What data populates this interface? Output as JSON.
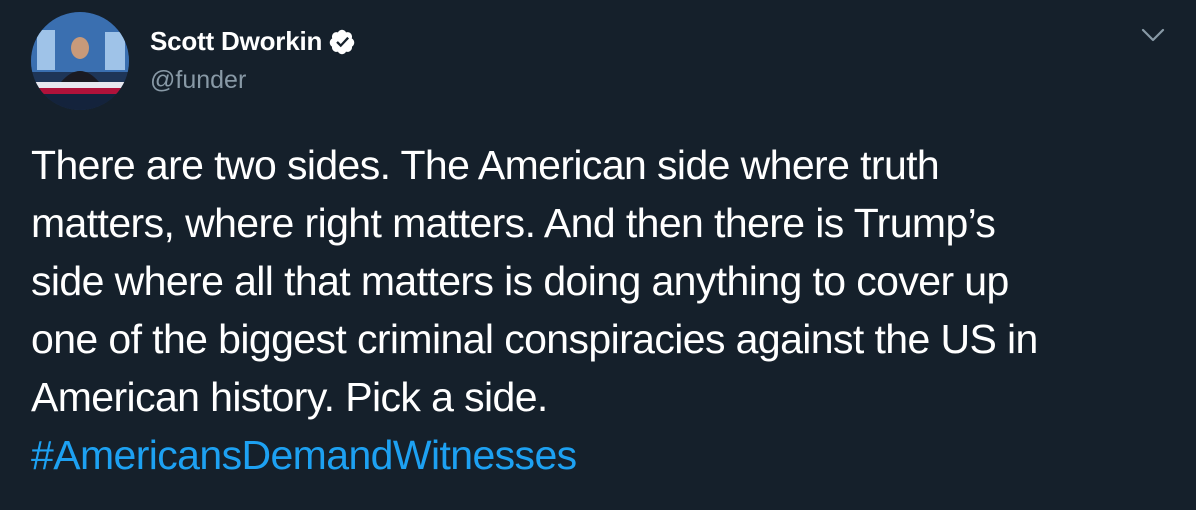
{
  "author": {
    "display_name": "Scott Dworkin",
    "handle": "@funder",
    "verified": true,
    "avatar_icon": "avatar-photo"
  },
  "tweet": {
    "lines": [
      "There are two sides. The American side where truth",
      "matters, where right matters. And then there is Trump’s",
      "side where all that matters is doing anything to cover up",
      "one of the biggest criminal conspiracies against the US in",
      "American history. Pick a side."
    ],
    "hashtag": "#AmericansDemandWitnesses"
  },
  "menu": {
    "icon": "chevron-down-icon"
  },
  "colors": {
    "background": "#15202b",
    "text": "#ffffff",
    "secondary": "#8899a6",
    "accent": "#1da1f2"
  }
}
